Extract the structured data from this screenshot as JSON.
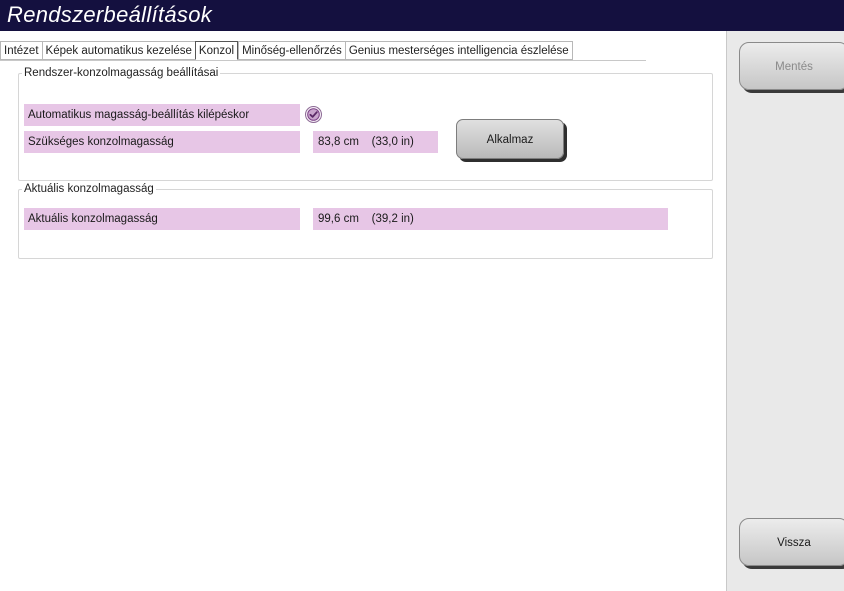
{
  "window": {
    "title": "Rendszerbeállítások"
  },
  "tabs": [
    {
      "label": "Intézet",
      "active": false
    },
    {
      "label": "Képek automatikus kezelése",
      "active": false
    },
    {
      "label": "Konzol",
      "active": true
    },
    {
      "label": "Minőség-ellenőrzés",
      "active": false
    },
    {
      "label": "Genius mesterséges intelligencia észlelése",
      "active": false
    }
  ],
  "system_group": {
    "legend": "Rendszer-konzolmagasság beállításai",
    "auto_height_label": "Automatikus magasság-beállítás kilépéskor",
    "auto_height_checked": true,
    "required_height_label": "Szükséges konzolmagasság",
    "required_height_value": "83,8 cm    (33,0 in)",
    "apply_button": "Alkalmaz"
  },
  "current_group": {
    "legend": "Aktuális konzolmagasság",
    "current_height_label": "Aktuális konzolmagasság",
    "current_height_value": "99,6 cm    (39,2 in)"
  },
  "sidebar": {
    "save_button": "Mentés",
    "save_enabled": false,
    "back_button": "Vissza",
    "back_enabled": true
  },
  "colors": {
    "titlebar": "#14103f",
    "field_background": "#e7c6e6",
    "checkmark": "#7a3f86",
    "sidebar": "#e9e9e9"
  },
  "icons": {
    "checkbox": "check-circle-icon"
  }
}
